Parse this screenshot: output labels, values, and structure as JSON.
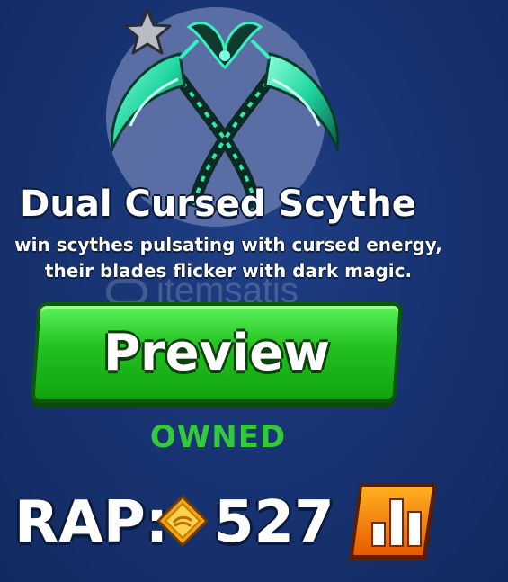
{
  "item": {
    "name": "Dual Cursed Scythe",
    "description_line1": "win scythes pulsating with cursed energy,",
    "description_line2": "their blades flicker with dark magic."
  },
  "watermark": {
    "text": "itemsatis"
  },
  "preview_button": {
    "label": "Preview"
  },
  "status": {
    "owned_label": "OWNED"
  },
  "rap": {
    "label": "RAP:",
    "value": "527"
  },
  "icons": {
    "star": "star-icon",
    "coin": "rap-coin-icon",
    "stats": "bar-chart-icon"
  },
  "colors": {
    "background": "#183474",
    "preview_green": "#22c01e",
    "owned_green": "#34c93a",
    "stats_orange": "#f27a05",
    "item_glow": "#39f5c0"
  }
}
